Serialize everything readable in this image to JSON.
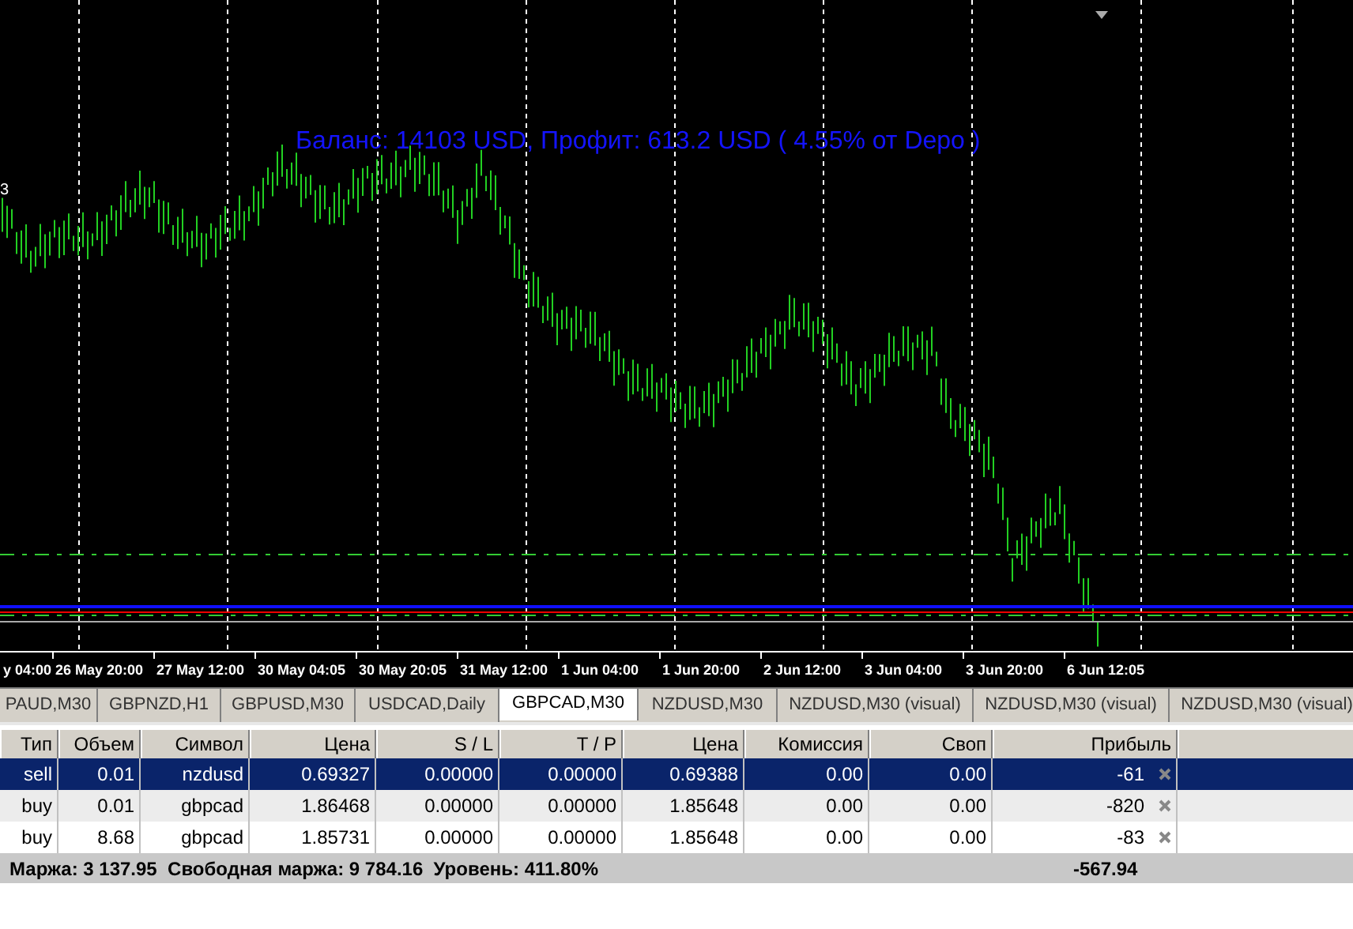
{
  "chart": {
    "annotation": "Баланс: 14103 USD, Профит: 613.2 USD ( 4.55% от Depo )",
    "edge_label": "3",
    "time_labels": [
      "y 04:00",
      "26 May 20:00",
      "27 May 12:00",
      "30 May 04:05",
      "30 May 20:05",
      "31 May 12:00",
      "1 Jun 04:00",
      "1 Jun 20:00",
      "2 Jun 12:00",
      "3 Jun 04:00",
      "3 Jun 20:00",
      "6 Jun 12:05"
    ]
  },
  "tabs": [
    {
      "label": "PAUD,M30",
      "selected": false
    },
    {
      "label": "GBPNZD,H1",
      "selected": false
    },
    {
      "label": "GBPUSD,M30",
      "selected": false
    },
    {
      "label": "USDCAD,Daily",
      "selected": false
    },
    {
      "label": "GBPCAD,M30",
      "selected": true
    },
    {
      "label": "NZDUSD,M30",
      "selected": false
    },
    {
      "label": "NZDUSD,M30 (visual)",
      "selected": false
    },
    {
      "label": "NZDUSD,M30 (visual)",
      "selected": false
    },
    {
      "label": "NZDUSD,M30 (visual)",
      "selected": false
    }
  ],
  "table": {
    "columns": [
      "Тип",
      "Объем",
      "Символ",
      "Цена",
      "S / L",
      "T / P",
      "Цена",
      "Комиссия",
      "Своп",
      "Прибыль"
    ],
    "rows": [
      {
        "cells": [
          "sell",
          "0.01",
          "nzdusd",
          "0.69327",
          "0.00000",
          "0.00000",
          "0.69388",
          "0.00",
          "0.00",
          "-61"
        ],
        "selected": true
      },
      {
        "cells": [
          "buy",
          "0.01",
          "gbpcad",
          "1.86468",
          "0.00000",
          "0.00000",
          "1.85648",
          "0.00",
          "0.00",
          "-820"
        ],
        "selected": false
      },
      {
        "cells": [
          "buy",
          "8.68",
          "gbpcad",
          "1.85731",
          "0.00000",
          "0.00000",
          "1.85648",
          "0.00",
          "0.00",
          "-83"
        ],
        "selected": false
      }
    ],
    "footer": {
      "summary": "Маржа: 3 137.95  Свободная маржа: 9 784.16  Уровень: 411.80%",
      "total": "-567.94"
    }
  }
}
